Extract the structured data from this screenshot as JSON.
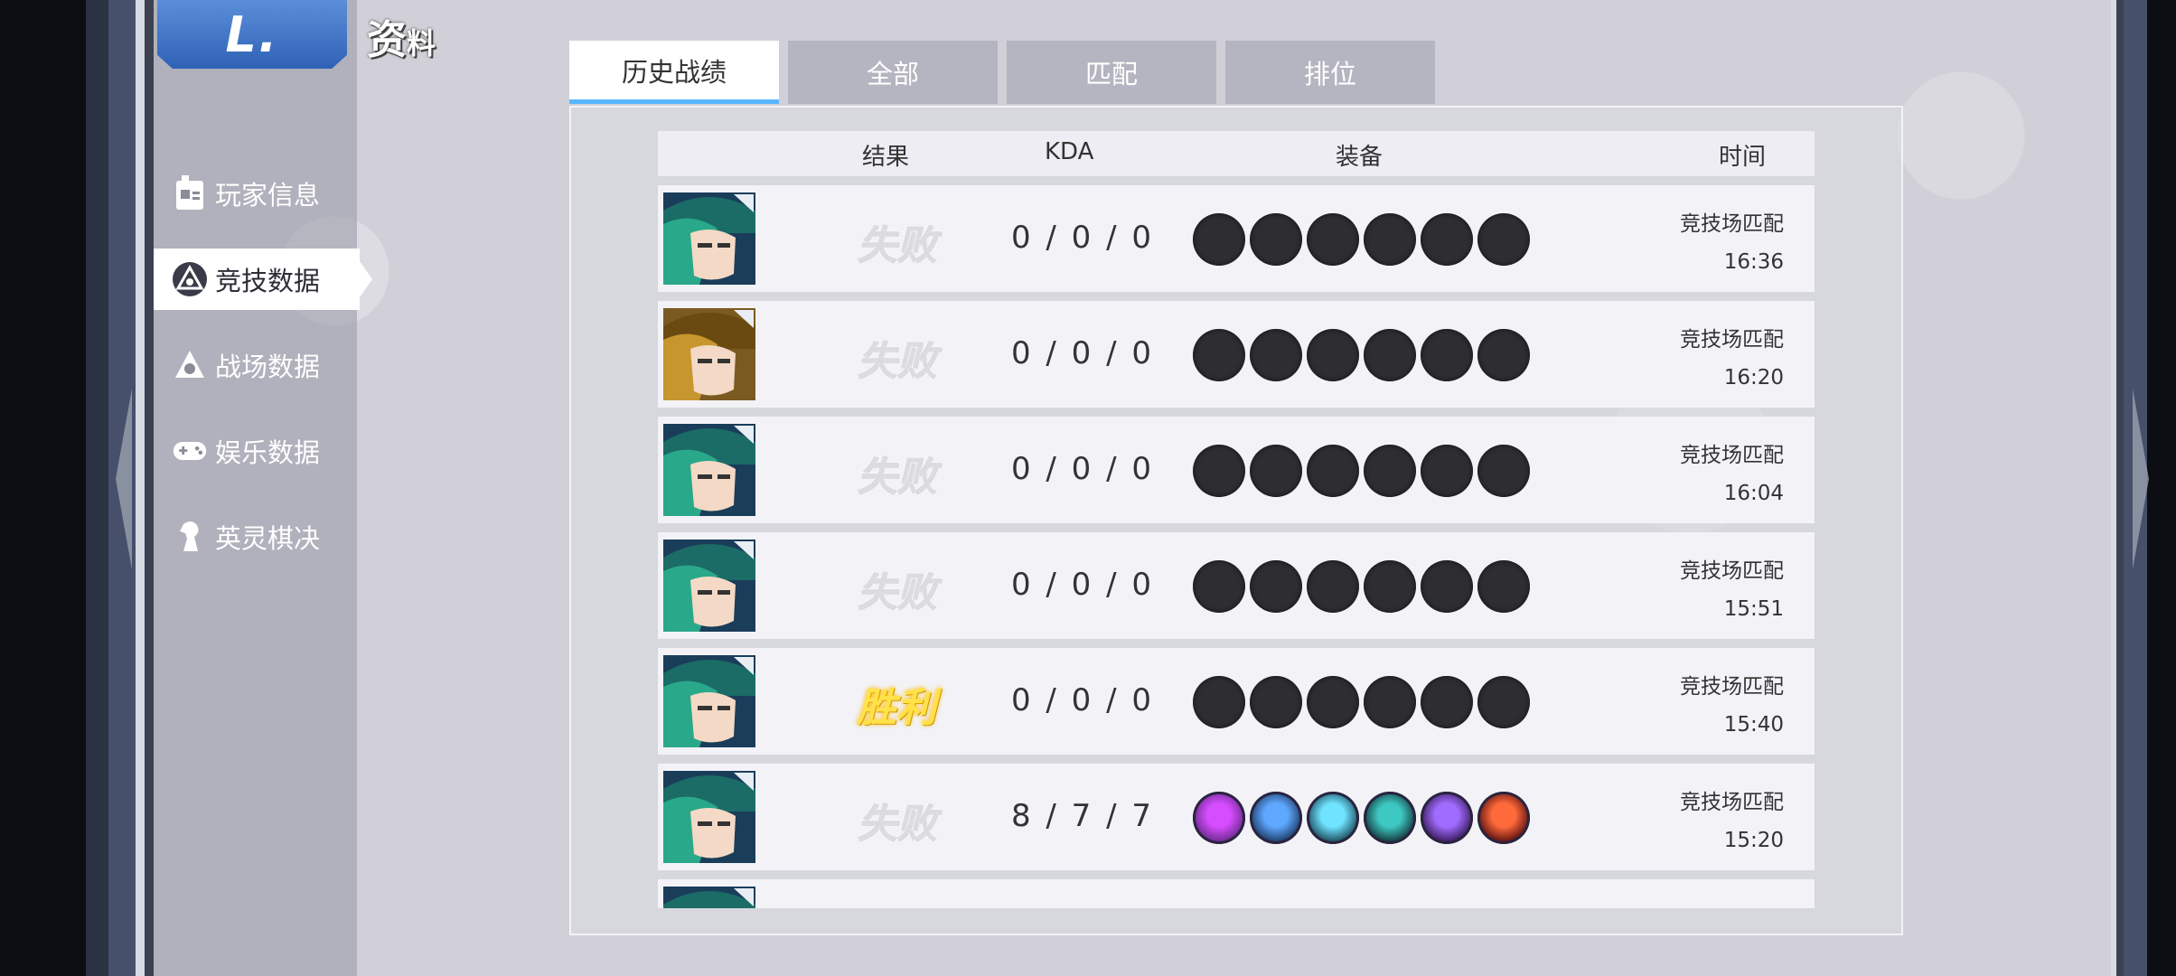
{
  "header": {
    "logo_text": "L.",
    "title_big": "资",
    "title_small": "料"
  },
  "sidebar": {
    "items": [
      {
        "label": "玩家信息",
        "icon": "profile-card-icon",
        "active": false
      },
      {
        "label": "竞技数据",
        "icon": "arena-triangle-icon",
        "active": true
      },
      {
        "label": "战场数据",
        "icon": "battlefield-icon",
        "active": false
      },
      {
        "label": "娱乐数据",
        "icon": "gamepad-icon",
        "active": false
      },
      {
        "label": "英灵棋决",
        "icon": "chess-knight-icon",
        "active": false
      }
    ]
  },
  "tabs": [
    {
      "label": "历史战绩",
      "active": true
    },
    {
      "label": "全部",
      "active": false
    },
    {
      "label": "匹配",
      "active": false
    },
    {
      "label": "排位",
      "active": false
    }
  ],
  "table": {
    "headers": {
      "result": "结果",
      "kda": "KDA",
      "equip": "装备",
      "time": "时间"
    },
    "rows": [
      {
        "hero": "green-hair-hero",
        "result": "失败",
        "win": false,
        "kda": "0 / 0 / 0",
        "items": [
          "empty",
          "empty",
          "empty",
          "empty",
          "empty",
          "empty"
        ],
        "mode": "竞技场匹配",
        "time": "16:36"
      },
      {
        "hero": "blond-hero",
        "result": "失败",
        "win": false,
        "kda": "0 / 0 / 0",
        "items": [
          "empty",
          "empty",
          "empty",
          "empty",
          "empty",
          "empty"
        ],
        "mode": "竞技场匹配",
        "time": "16:20"
      },
      {
        "hero": "green-hair-hero",
        "result": "失败",
        "win": false,
        "kda": "0 / 0 / 0",
        "items": [
          "empty",
          "empty",
          "empty",
          "empty",
          "empty",
          "empty"
        ],
        "mode": "竞技场匹配",
        "time": "16:04"
      },
      {
        "hero": "green-hair-hero",
        "result": "失败",
        "win": false,
        "kda": "0 / 0 / 0",
        "items": [
          "empty",
          "empty",
          "empty",
          "empty",
          "empty",
          "empty"
        ],
        "mode": "竞技场匹配",
        "time": "15:51"
      },
      {
        "hero": "green-hair-hero",
        "result": "胜利",
        "win": true,
        "kda": "0 / 0 / 0",
        "items": [
          "empty",
          "empty",
          "empty",
          "empty",
          "empty",
          "empty"
        ],
        "mode": "竞技场匹配",
        "time": "15:40"
      },
      {
        "hero": "green-hair-hero",
        "result": "失败",
        "win": false,
        "kda": "8 / 7 / 7",
        "items": [
          "purple-orb",
          "blue-dragon",
          "cyan-fighter",
          "teal-mage",
          "violet-warrior",
          "red-blade"
        ],
        "mode": "竞技场匹配",
        "time": "15:20"
      },
      {
        "hero": "green-hair-hero",
        "result": "",
        "win": false,
        "kda": "",
        "items": [],
        "mode": "",
        "time": ""
      }
    ]
  },
  "colors": {
    "accent": "#58b6ff",
    "win": "#ffe24a",
    "lose": "#dcdce0",
    "logo": "#3a72c8"
  }
}
